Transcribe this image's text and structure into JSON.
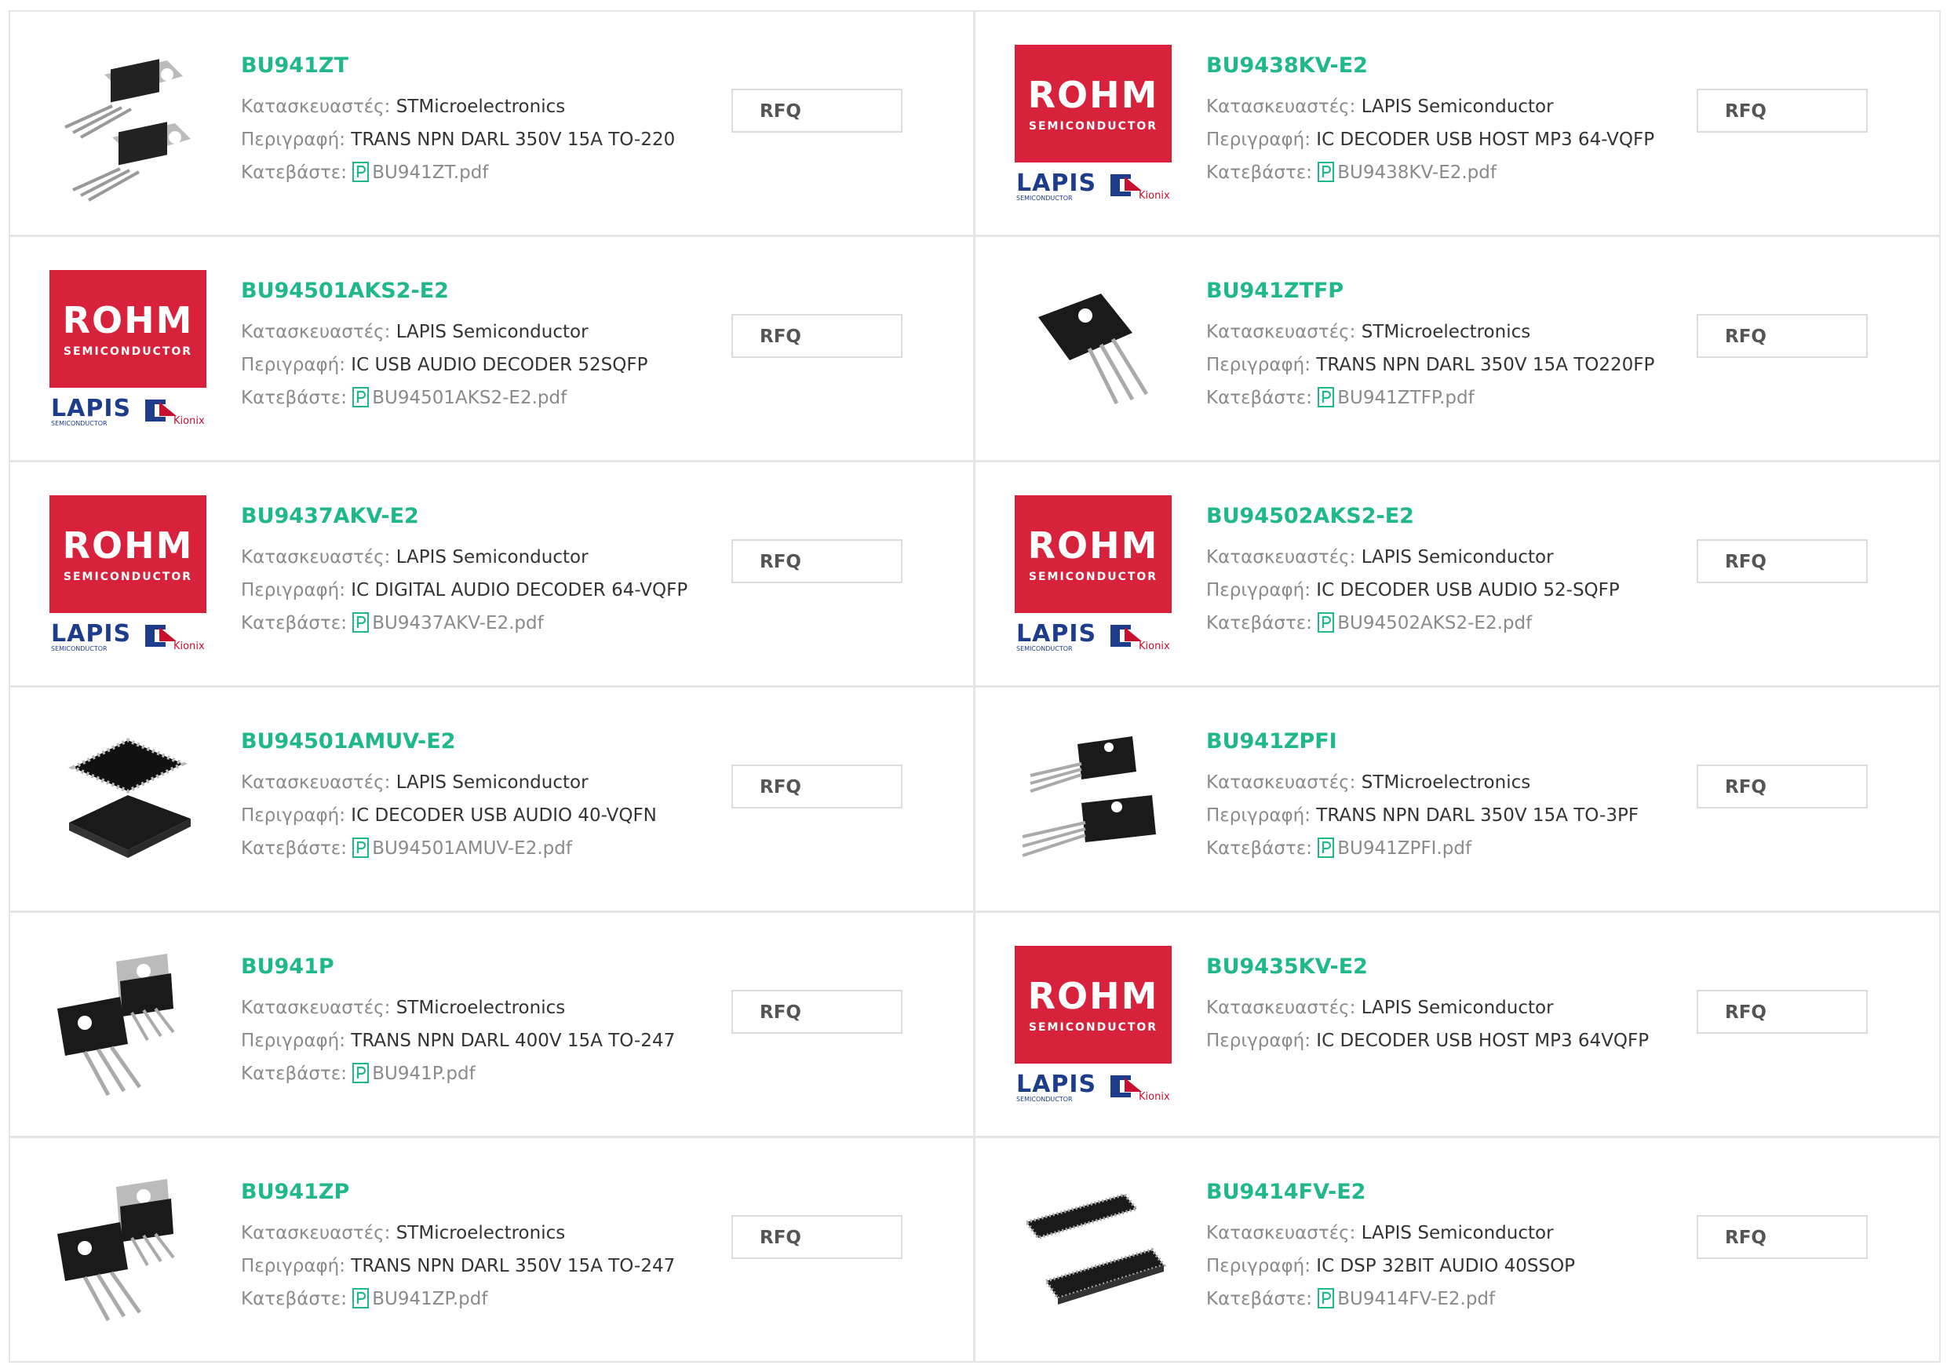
{
  "labels": {
    "manufacturer": "Κατασκευαστές:",
    "description": "Περιγραφή:",
    "download": "Κατεβάστε:",
    "rfq": "RFQ"
  },
  "colors": {
    "part_number": "#1fb88a",
    "rohm_red": "#d8213a",
    "pdf_icon": "#1fb88a"
  },
  "products": [
    {
      "part": "BU941ZT",
      "manufacturer": "STMicroelectronics",
      "description": "TRANS NPN DARL 350V 15A TO-220",
      "pdf": "BU941ZT.pdf",
      "image": "to220-transistor"
    },
    {
      "part": "BU9438KV-E2",
      "manufacturer": "LAPIS Semiconductor",
      "description": "IC DECODER USB HOST MP3 64-VQFP",
      "pdf": "BU9438KV-E2.pdf",
      "image": "rohm-lapis-logo"
    },
    {
      "part": "BU94501AKS2-E2",
      "manufacturer": "LAPIS Semiconductor",
      "description": "IC USB AUDIO DECODER 52SQFP",
      "pdf": "BU94501AKS2-E2.pdf",
      "image": "rohm-lapis-logo"
    },
    {
      "part": "BU941ZTFP",
      "manufacturer": "STMicroelectronics",
      "description": "TRANS NPN DARL 350V 15A TO220FP",
      "pdf": "BU941ZTFP.pdf",
      "image": "to220fp-transistor"
    },
    {
      "part": "BU9437AKV-E2",
      "manufacturer": "LAPIS Semiconductor",
      "description": "IC DIGITAL AUDIO DECODER 64-VQFP",
      "pdf": "BU9437AKV-E2.pdf",
      "image": "rohm-lapis-logo"
    },
    {
      "part": "BU94502AKS2-E2",
      "manufacturer": "LAPIS Semiconductor",
      "description": "IC DECODER USB AUDIO 52-SQFP",
      "pdf": "BU94502AKS2-E2.pdf",
      "image": "rohm-lapis-logo"
    },
    {
      "part": "BU94501AMUV-E2",
      "manufacturer": "LAPIS Semiconductor",
      "description": "IC DECODER USB AUDIO 40-VQFN",
      "pdf": "BU94501AMUV-E2.pdf",
      "image": "qfn-chip"
    },
    {
      "part": "BU941ZPFI",
      "manufacturer": "STMicroelectronics",
      "description": "TRANS NPN DARL 350V 15A TO-3PF",
      "pdf": "BU941ZPFI.pdf",
      "image": "to3pf-transistor"
    },
    {
      "part": "BU941P",
      "manufacturer": "STMicroelectronics",
      "description": "TRANS NPN DARL 400V 15A TO-247",
      "pdf": "BU941P.pdf",
      "image": "to247-transistor"
    },
    {
      "part": "BU9435KV-E2",
      "manufacturer": "LAPIS Semiconductor",
      "description": "IC DECODER USB HOST MP3 64VQFP",
      "pdf": "",
      "image": "rohm-lapis-logo"
    },
    {
      "part": "BU941ZP",
      "manufacturer": "STMicroelectronics",
      "description": "TRANS NPN DARL 350V 15A TO-247",
      "pdf": "BU941ZP.pdf",
      "image": "to247-transistor"
    },
    {
      "part": "BU9414FV-E2",
      "manufacturer": "LAPIS Semiconductor",
      "description": "IC DSP 32BIT AUDIO 40SSOP",
      "pdf": "BU9414FV-E2.pdf",
      "image": "ssop-chip"
    }
  ],
  "logo": {
    "rohm": "ROHM",
    "rohm_sub": "SEMICONDUCTOR",
    "lapis": "LAPIS",
    "lapis_sub": "SEMICONDUCTOR",
    "kionix": "Kionix"
  }
}
